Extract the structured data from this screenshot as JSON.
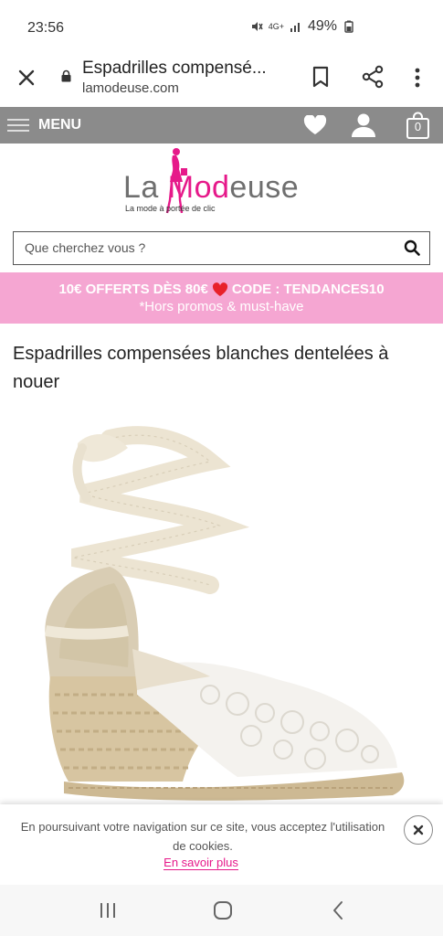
{
  "status_bar": {
    "time": "23:56",
    "network": "4G+",
    "battery": "49%"
  },
  "browser": {
    "page_title": "Espadrilles compensé...",
    "url": "lamodeuse.com"
  },
  "site_header": {
    "menu_label": "MENU",
    "cart_count": "0"
  },
  "logo": {
    "part1": "La ",
    "part2": "Mod",
    "part3": "euse",
    "tagline": "La mode à portée de clic"
  },
  "search": {
    "placeholder": "Que cherchez vous ?"
  },
  "promo": {
    "line1_before": "10€ OFFERTS DÈS 80€",
    "line1_after": "CODE : TENDANCES10",
    "line2": "*Hors promos & must-have"
  },
  "product": {
    "title": "Espadrilles compensées blanches dentelées à nouer"
  },
  "cookie": {
    "text": "En poursuivant votre navigation sur ce site, vous acceptez l'utilisation de cookies.",
    "link": "En savoir plus"
  },
  "colors": {
    "brand_pink": "#e6198a",
    "header_gray": "#8b8b8b",
    "promo_pink": "#f5a6d2"
  },
  "icons": [
    "close-icon",
    "lock-icon",
    "bookmark-icon",
    "share-icon",
    "more-vert-icon",
    "hamburger-icon",
    "heart-icon",
    "user-icon",
    "bag-icon",
    "search-icon",
    "close-circle-icon",
    "recent-apps-icon",
    "home-icon",
    "back-icon"
  ]
}
